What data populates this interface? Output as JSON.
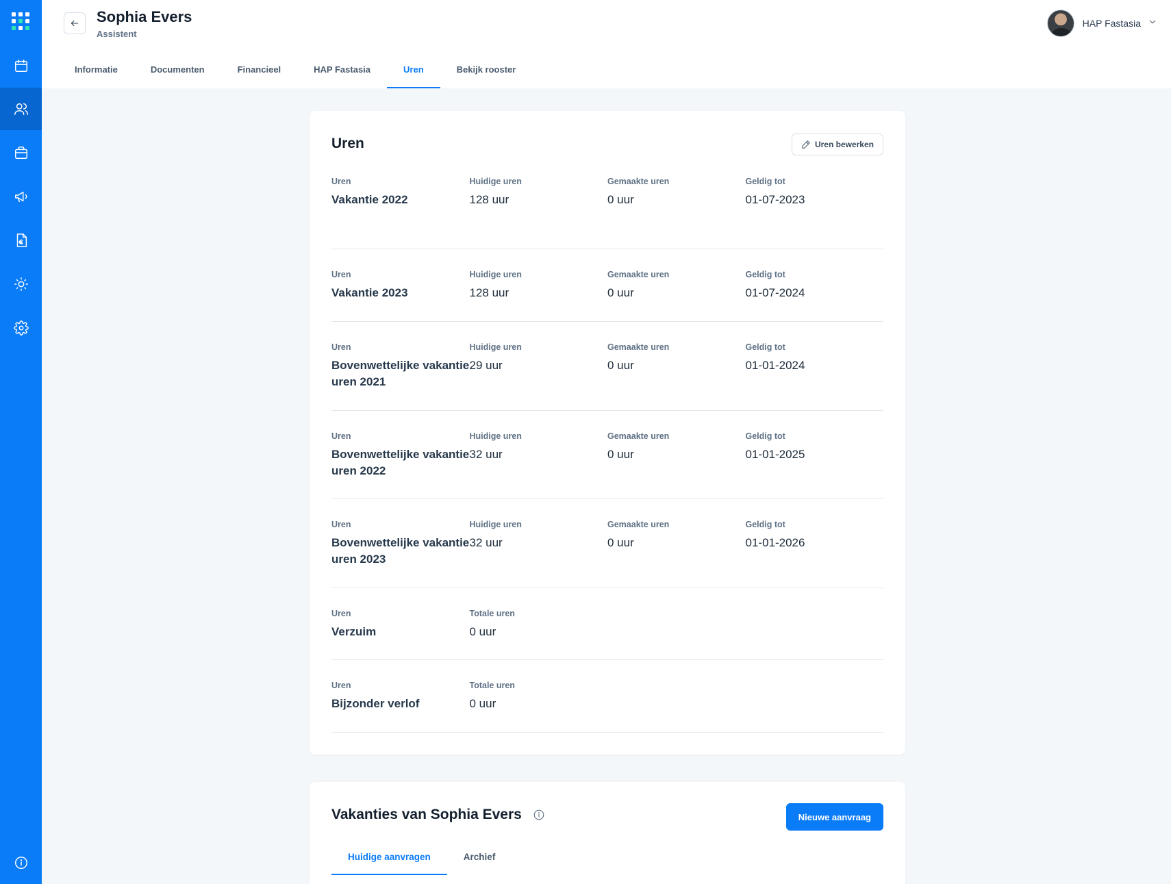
{
  "header": {
    "name": "Sophia Evers",
    "role": "Assistent",
    "user": "HAP Fastasia"
  },
  "tabs": [
    {
      "label": "Informatie"
    },
    {
      "label": "Documenten"
    },
    {
      "label": "Financieel"
    },
    {
      "label": "HAP Fastasia"
    },
    {
      "label": "Uren",
      "active": true
    },
    {
      "label": "Bekijk rooster"
    }
  ],
  "sidebar": {
    "icons": [
      "apps-logo-icon",
      "calendar-icon",
      "users-icon",
      "briefcase-icon",
      "megaphone-icon",
      "invoice-euro-icon",
      "sun-icon",
      "gear-icon",
      "info-icon"
    ]
  },
  "uren": {
    "title": "Uren",
    "edit_label": "Uren bewerken",
    "rows": [
      {
        "c1_label": "Uren",
        "c1_value": "Vakantie 2022",
        "c2_label": "Huidige uren",
        "c2_value": "128 uur",
        "c3_label": "Gemaakte uren",
        "c3_value": "0 uur",
        "c4_label": "Geldig tot",
        "c4_value": "01-07-2023"
      },
      {
        "c1_label": "Uren",
        "c1_value": "Vakantie 2023",
        "c2_label": "Huidige uren",
        "c2_value": "128 uur",
        "c3_label": "Gemaakte uren",
        "c3_value": "0 uur",
        "c4_label": "Geldig tot",
        "c4_value": "01-07-2024"
      },
      {
        "c1_label": "Uren",
        "c1_value": "Bovenwettelijke vakantie uren 2021",
        "c2_label": "Huidige uren",
        "c2_value": "29 uur",
        "c3_label": "Gemaakte uren",
        "c3_value": "0 uur",
        "c4_label": "Geldig tot",
        "c4_value": "01-01-2024"
      },
      {
        "c1_label": "Uren",
        "c1_value": "Bovenwettelijke vakantie uren 2022",
        "c2_label": "Huidige uren",
        "c2_value": "32 uur",
        "c3_label": "Gemaakte uren",
        "c3_value": "0 uur",
        "c4_label": "Geldig tot",
        "c4_value": "01-01-2025"
      },
      {
        "c1_label": "Uren",
        "c1_value": "Bovenwettelijke vakantie uren 2023",
        "c2_label": "Huidige uren",
        "c2_value": "32 uur",
        "c3_label": "Gemaakte uren",
        "c3_value": "0 uur",
        "c4_label": "Geldig tot",
        "c4_value": "01-01-2026"
      },
      {
        "c1_label": "Uren",
        "c1_value": "Verzuim",
        "c2_label": "Totale uren",
        "c2_value": "0 uur"
      },
      {
        "c1_label": "Uren",
        "c1_value": "Bijzonder verlof",
        "c2_label": "Totale uren",
        "c2_value": "0 uur"
      }
    ]
  },
  "vakanties": {
    "title": "Vakanties van Sophia Evers",
    "new_request_label": "Nieuwe aanvraag",
    "tabs": [
      {
        "label": "Huidige aanvragen",
        "active": true
      },
      {
        "label": "Archief"
      }
    ]
  }
}
